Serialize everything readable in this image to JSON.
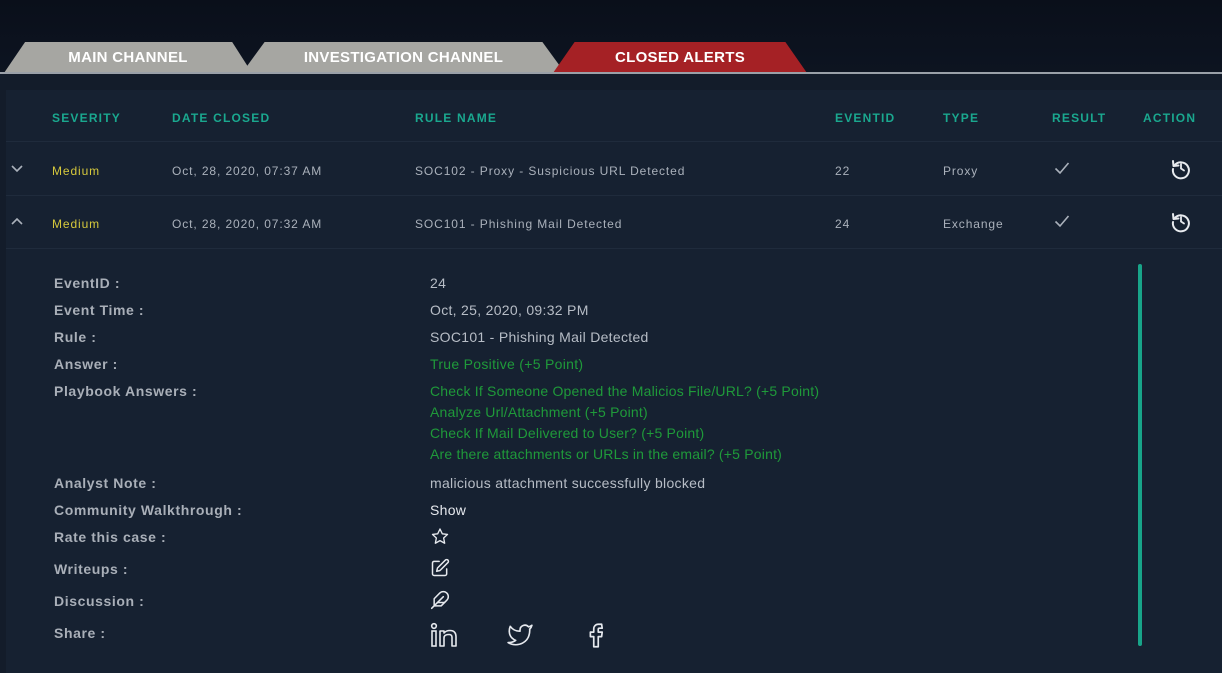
{
  "tabs": [
    {
      "label": "MAIN CHANNEL"
    },
    {
      "label": "INVESTIGATION CHANNEL"
    },
    {
      "label": "CLOSED ALERTS"
    }
  ],
  "table": {
    "headers": [
      "SEVERITY",
      "DATE CLOSED",
      "RULE NAME",
      "EVENTID",
      "TYPE",
      "RESULT",
      "ACTION"
    ],
    "rows": [
      {
        "severity": "Medium",
        "date_closed": "Oct, 28, 2020, 07:37 AM",
        "rule_name": "SOC102 - Proxy - Suspicious URL Detected",
        "eventid": "22",
        "type": "Proxy",
        "expanded": false
      },
      {
        "severity": "Medium",
        "date_closed": "Oct, 28, 2020, 07:32 AM",
        "rule_name": "SOC101 - Phishing Mail Detected",
        "eventid": "24",
        "type": "Exchange",
        "expanded": true
      }
    ]
  },
  "details": {
    "labels": {
      "eventid": "EventID :",
      "event_time": "Event Time :",
      "rule": "Rule :",
      "answer": "Answer :",
      "playbook": "Playbook Answers :",
      "analyst_note": "Analyst Note :",
      "walkthrough": "Community Walkthrough :",
      "rate": "Rate this case :",
      "writeups": "Writeups :",
      "discussion": "Discussion :",
      "share": "Share :"
    },
    "values": {
      "eventid": "24",
      "event_time": "Oct, 25, 2020, 09:32 PM",
      "rule": "SOC101 - Phishing Mail Detected",
      "answer": "True Positive (+5 Point)",
      "playbook_answers": [
        "Check If Someone Opened the Malicios File/URL? (+5 Point)",
        "Analyze Url/Attachment (+5 Point)",
        "Check If Mail Delivered to User? (+5 Point)",
        "Are there attachments or URLs in the email? (+5 Point)"
      ],
      "analyst_note": "malicious attachment successfully blocked",
      "walkthrough": "Show"
    },
    "icons": {
      "rate": "star-icon",
      "writeups": "edit-icon",
      "discussion": "feather-icon",
      "share": [
        "linkedin-icon",
        "twitter-icon",
        "facebook-icon"
      ]
    }
  },
  "colors": {
    "accent": "#1aa88f",
    "severity_medium": "#d6c93c",
    "positive": "#1f9a3a",
    "active_tab": "#a52125",
    "inactive_tab": "#a6a6a2"
  }
}
